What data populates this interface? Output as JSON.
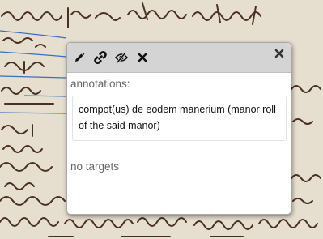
{
  "viewer": {
    "background_color": "#eae3d4",
    "ink_color": "#4a3020",
    "guideline_color": "#3a6fc4"
  },
  "popup": {
    "toolbar": {
      "edit_icon": "pencil-icon",
      "link_icon": "link-icon",
      "hide_icon": "eye-slash-icon",
      "delete_icon": "x-icon",
      "close_icon": "close-icon"
    },
    "annotations_label": "annotations:",
    "annotations": [
      {
        "text": "compot(us) de eodem manerium (manor roll of the said manor)"
      }
    ],
    "targets_label": "no targets"
  }
}
